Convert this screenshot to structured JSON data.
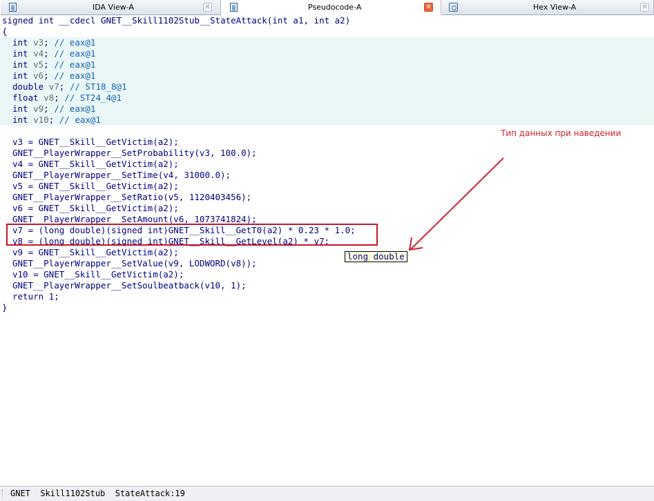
{
  "tabs": [
    {
      "label": "IDA View-A"
    },
    {
      "label": "Pseudocode-A"
    },
    {
      "label": "Hex View-A"
    }
  ],
  "code": {
    "signature": "signed int __cdecl GNET__Skill1102Stub__StateAttack(int a1, int a2)",
    "open_brace": "{",
    "decls": [
      {
        "type": "int",
        "name": "v3",
        "comment": "// eax@1"
      },
      {
        "type": "int",
        "name": "v4",
        "comment": "// eax@1"
      },
      {
        "type": "int",
        "name": "v5",
        "comment": "// eax@1"
      },
      {
        "type": "int",
        "name": "v6",
        "comment": "// eax@1"
      },
      {
        "type": "double",
        "name": "v7",
        "comment": "// ST18_8@1"
      },
      {
        "type": "float",
        "name": "v8",
        "comment": "// ST24_4@1"
      },
      {
        "type": "int",
        "name": "v9",
        "comment": "// eax@1"
      },
      {
        "type": "int",
        "name": "v10",
        "comment": "// eax@1"
      }
    ],
    "body": [
      "v3 = GNET__Skill__GetVictim(a2);",
      "GNET__PlayerWrapper__SetProbability(v3, 100.0);",
      "v4 = GNET__Skill__GetVictim(a2);",
      "GNET__PlayerWrapper__SetTime(v4, 31000.0);",
      "v5 = GNET__Skill__GetVictim(a2);",
      "GNET__PlayerWrapper__SetRatio(v5, 1120403456);",
      "v6 = GNET__Skill__GetVictim(a2);",
      "GNET__PlayerWrapper__SetAmount(v6, 1073741824);",
      "v7 = (long double)(signed int)GNET__Skill__GetT0(a2) * 0.23 * 1.0;",
      "v8 = (long double)(signed int)GNET__Skill__GetLevel(a2) * v7;",
      "v9 = GNET__Skill__GetVictim(a2);",
      "GNET__PlayerWrapper__SetValue(v9, LODWORD(v8));",
      "v10 = GNET__Skill__GetVictim(a2);",
      "GNET__PlayerWrapper__SetSoulbeatback(v10, 1);",
      "return 1;"
    ],
    "close_brace": "}"
  },
  "tooltip": {
    "text": "long double"
  },
  "annotation": {
    "text": "Тип данных при наведении"
  },
  "status": {
    "text": "GNET  Skill1102Stub  StateAttack:19"
  },
  "colors": {
    "annotation": "#d0202a",
    "highlight": "#c8142a",
    "decl_background": "#eaf7f7"
  }
}
